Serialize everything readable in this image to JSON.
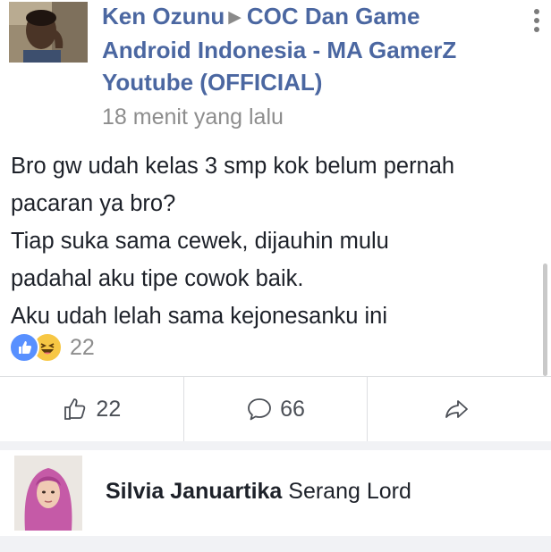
{
  "post": {
    "author": "Ken Ozunu",
    "group_line1": "COC Dan Game",
    "group_line2": "Android Indonesia - MA GamerZ",
    "group_line3": "Youtube (OFFICIAL)",
    "timestamp": "18 menit yang lalu",
    "body_lines": [
      "Bro gw udah kelas 3 smp kok belum pernah",
      "pacaran ya bro?",
      "Tiap suka sama cewek, dijauhin mulu",
      "padahal aku tipe cowok baik.",
      "Aku udah lelah sama kejonesanku ini"
    ]
  },
  "reactions": {
    "types": [
      "like-icon",
      "haha-icon"
    ],
    "count": "22"
  },
  "actions": {
    "like_count": "22",
    "comment_count": "66",
    "share_icon": "share-arrow-icon"
  },
  "comment": {
    "name": "Silvia Januartika",
    "text": "Serang Lord"
  },
  "colors": {
    "link_blue": "#4b67a1",
    "text_dark": "#1d2129",
    "text_muted": "#8d8d8d",
    "like_blue": "#5890ff",
    "haha_yellow": "#f7c744",
    "divider": "#dddfe2",
    "comment_bg": "#f1f2f5"
  }
}
